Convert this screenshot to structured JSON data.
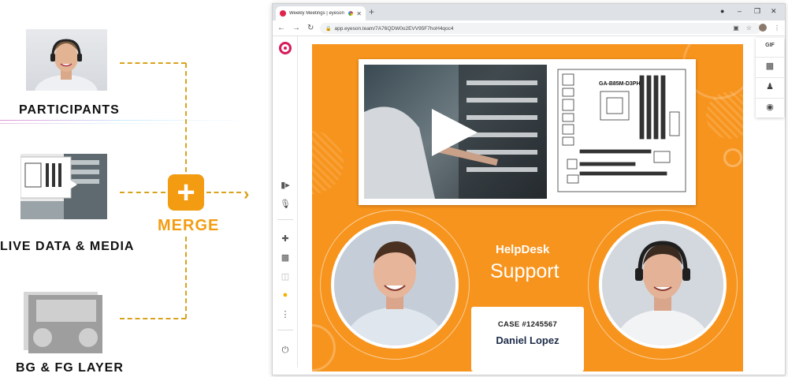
{
  "diagram": {
    "participants_label": "PARTICIPANTS",
    "media_label": "LIVE DATA & MEDIA",
    "layer_label": "BG & FG LAYER",
    "merge_label": "MERGE",
    "merge_icon": "plus-icon",
    "accent": "#f39c12"
  },
  "browser": {
    "tab_title": "Weekly Meetings | eyeson",
    "url": "app.eyeson.team/7A76QDW0o2EVV95F7hoH4qoc4",
    "new_tab_icon": "+"
  },
  "stage": {
    "background": "#f7941d",
    "brand_line1": "HelpDesk",
    "brand_line2": "Support",
    "board_title": "GA-B85M-D3PH",
    "case_number": "CASE #1245567",
    "agent_name": "Daniel Lopez"
  },
  "right_panel": {
    "gif_label": "GIF"
  }
}
